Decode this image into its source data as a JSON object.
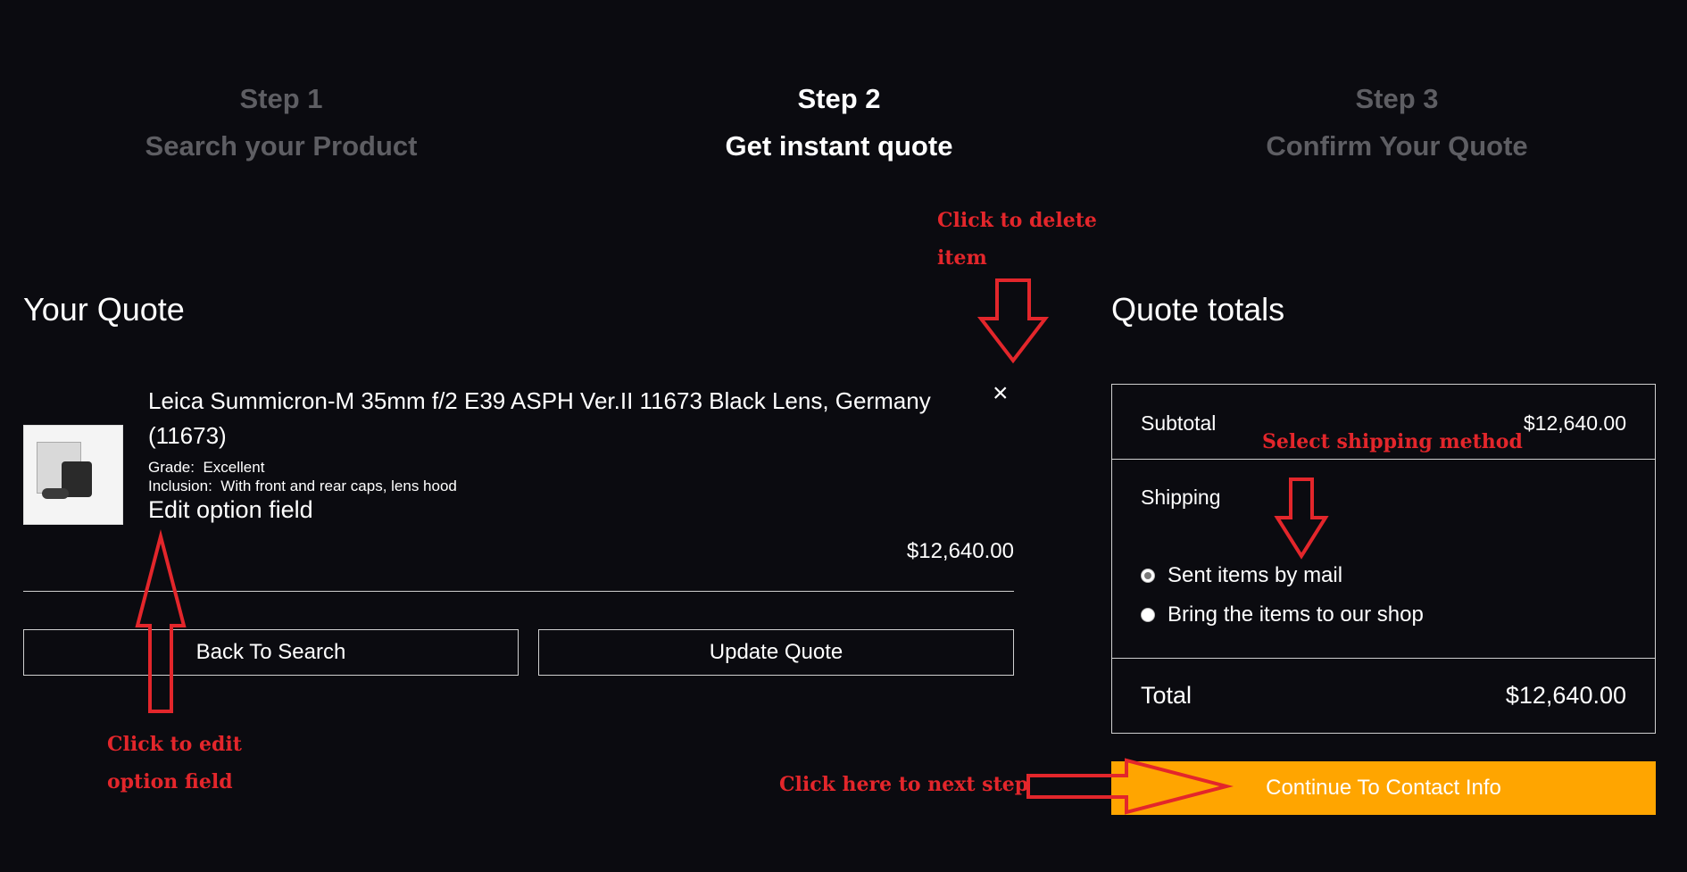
{
  "steps": [
    {
      "num": "Step 1",
      "label": "Search your Product"
    },
    {
      "num": "Step 2",
      "label": "Get instant quote"
    },
    {
      "num": "Step 3",
      "label": "Confirm Your Quote"
    }
  ],
  "quote": {
    "heading": "Your Quote",
    "item": {
      "title": "Leica Summicron-M 35mm f/2 E39 ASPH Ver.II 11673 Black Lens, Germany (11673)",
      "grade_label": "Grade:",
      "grade_value": "Excellent",
      "inclusion_label": "Inclusion:",
      "inclusion_value": "With front and rear caps, lens hood",
      "edit_label": "Edit option field",
      "price": "$12,640.00",
      "delete_glyph": "×"
    },
    "buttons": {
      "back": "Back To Search",
      "update": "Update Quote"
    }
  },
  "totals": {
    "heading": "Quote totals",
    "subtotal_label": "Subtotal",
    "subtotal_value": "$12,640.00",
    "shipping_label": "Shipping",
    "shipping_options": [
      {
        "label": "Sent items by mail",
        "checked": true
      },
      {
        "label": "Bring the items to our shop",
        "checked": false
      }
    ],
    "total_label": "Total",
    "total_value": "$12,640.00",
    "continue": "Continue To Contact Info"
  },
  "annotations": {
    "delete_line1": "Click to delete",
    "delete_line2": "item",
    "shipping": "Select shipping method",
    "edit_line1": "Click to edit",
    "edit_line2": "option field",
    "next": "Click here to next step"
  },
  "colors": {
    "background": "#0b0b10",
    "accent": "#ffa500",
    "annotation": "#e3262b",
    "dim_text": "#5e5e63"
  }
}
